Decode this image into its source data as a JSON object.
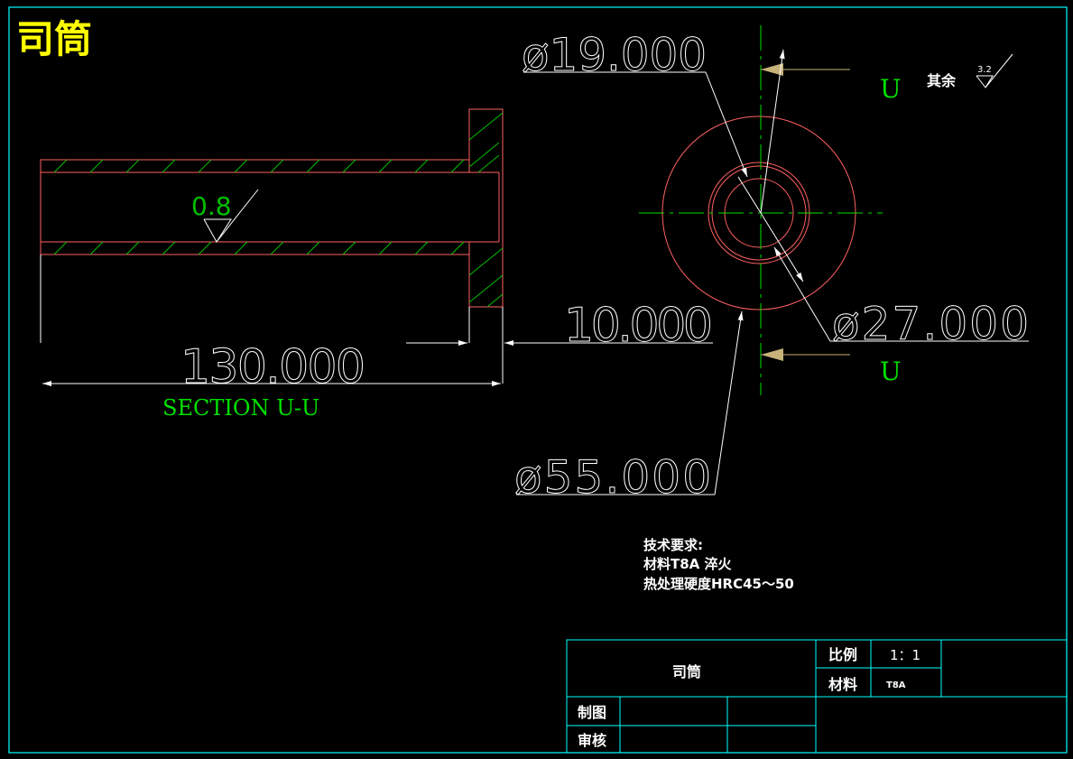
{
  "title": "司筒",
  "section_label": "SECTION U-U",
  "section_marks": [
    "U",
    "U"
  ],
  "roughness": {
    "main": "0.8",
    "other_label": "其余",
    "other_value": "3.2"
  },
  "dimensions": {
    "d19": "ø19.000",
    "d27": "ø27.000",
    "d55": "ø55.000",
    "len10": "10.000",
    "len130": "130.000"
  },
  "tech_requirements": {
    "heading": "技术要求:",
    "line1": "材料T8A  淬火",
    "line2": "热处理硬度HRC45～50"
  },
  "title_block": {
    "part_name": "司筒",
    "scale_label": "比例",
    "scale_value": "1：1",
    "material_label": "材料",
    "material_value": "T8A",
    "drawn_label": "制图",
    "checked_label": "审核"
  },
  "colors": {
    "frame": "#00ffff",
    "part": "#ff6060",
    "hatch": "#00c000",
    "dim": "#ffffff",
    "center": "#00e000",
    "title": "#ffff00",
    "arrow_tan": "#c8b27a"
  }
}
